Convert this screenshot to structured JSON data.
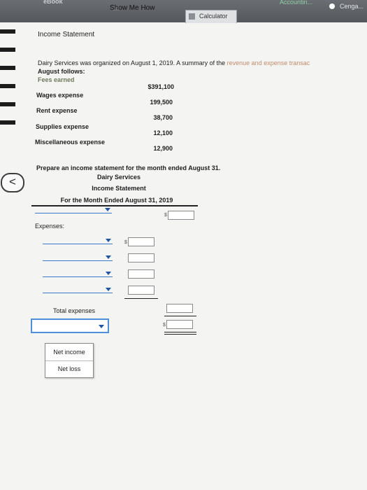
{
  "topbar": {
    "ebook_label": "eBook",
    "show_me_how": "Show Me How",
    "calculator": "Calculator",
    "accounting": "Accountin...",
    "cengage": "Cenga..."
  },
  "section_title": "Income Statement",
  "intro_line1_a": "Dairy Services was organized on August 1, 2019. A summary of the ",
  "intro_line1_b": "revenue and expense transac",
  "intro_line2": "August follows:",
  "accounts": [
    {
      "name": "Fees earned",
      "amount": "$391,100"
    },
    {
      "name": "Wages expense",
      "amount": "199,500"
    },
    {
      "name": "Rent expense",
      "amount": "38,700"
    },
    {
      "name": "Supplies expense",
      "amount": "12,100"
    },
    {
      "name": "Miscellaneous expense",
      "amount": "12,900"
    }
  ],
  "prompt": "Prepare an income statement for the month ended August 31.",
  "statement": {
    "company": "Dairy Services",
    "title": "Income Statement",
    "period": "For the Month Ended August 31, 2019",
    "expenses_label": "Expenses:",
    "total_expenses_label": "Total expenses",
    "dollar_sign": "$"
  },
  "net_options": [
    "Net income",
    "Net loss"
  ]
}
